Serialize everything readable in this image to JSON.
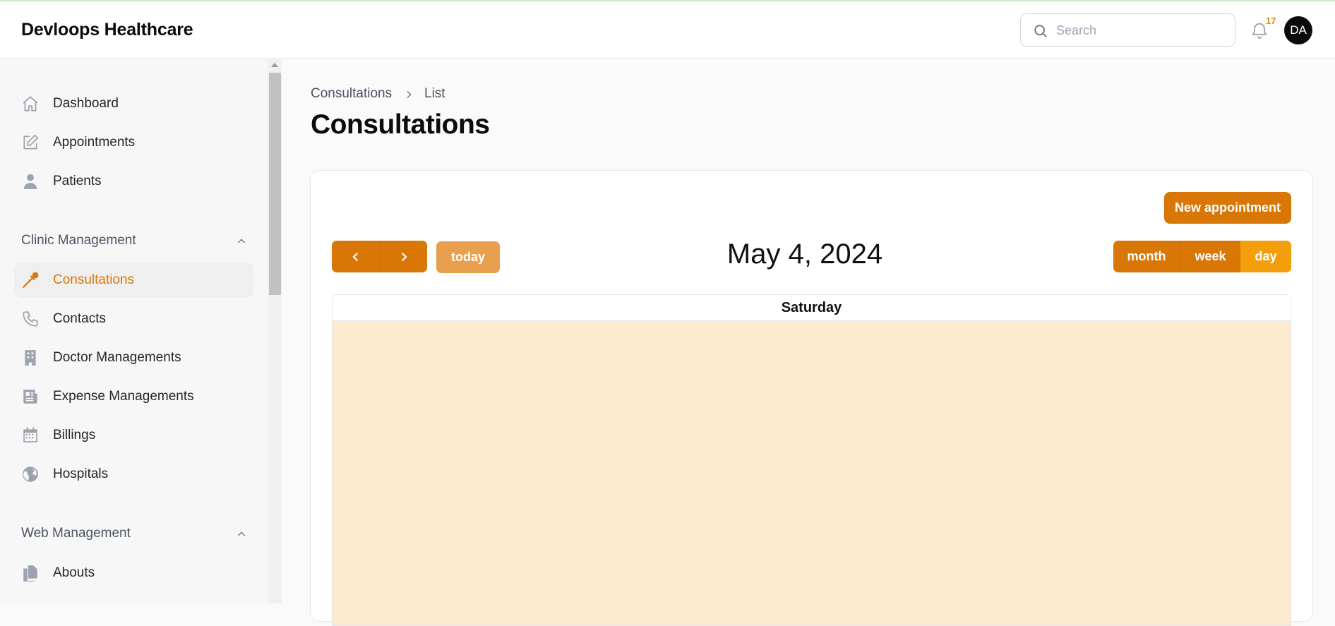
{
  "header": {
    "brand": "Devloops Healthcare",
    "search_placeholder": "Search",
    "notification_count": "17",
    "avatar_initials": "DA"
  },
  "sidebar": {
    "items": [
      {
        "label": "Dashboard",
        "icon": "home-icon"
      },
      {
        "label": "Appointments",
        "icon": "edit-icon"
      },
      {
        "label": "Patients",
        "icon": "user-icon"
      }
    ],
    "groups": [
      {
        "label": "Clinic Management",
        "items": [
          {
            "label": "Consultations",
            "icon": "eyedropper-icon",
            "active": true
          },
          {
            "label": "Contacts",
            "icon": "phone-icon"
          },
          {
            "label": "Doctor Managements",
            "icon": "building-icon"
          },
          {
            "label": "Expense Managements",
            "icon": "newspaper-icon"
          },
          {
            "label": "Billings",
            "icon": "calendar-icon"
          },
          {
            "label": "Hospitals",
            "icon": "globe-icon"
          }
        ]
      },
      {
        "label": "Web Management",
        "items": [
          {
            "label": "Abouts",
            "icon": "documents-icon"
          }
        ]
      }
    ]
  },
  "breadcrumb": {
    "parent": "Consultations",
    "current": "List"
  },
  "page_title": "Consultations",
  "calendar": {
    "new_button": "New appointment",
    "today_button": "today",
    "current_date": "May 4, 2024",
    "views": [
      "month",
      "week",
      "day"
    ],
    "active_view": "day",
    "day_header": "Saturday"
  },
  "colors": {
    "accent": "#d97706",
    "accent_active": "#f59e0b",
    "today_bg": "#e8a04e",
    "today_highlight": "#fcebcf"
  }
}
